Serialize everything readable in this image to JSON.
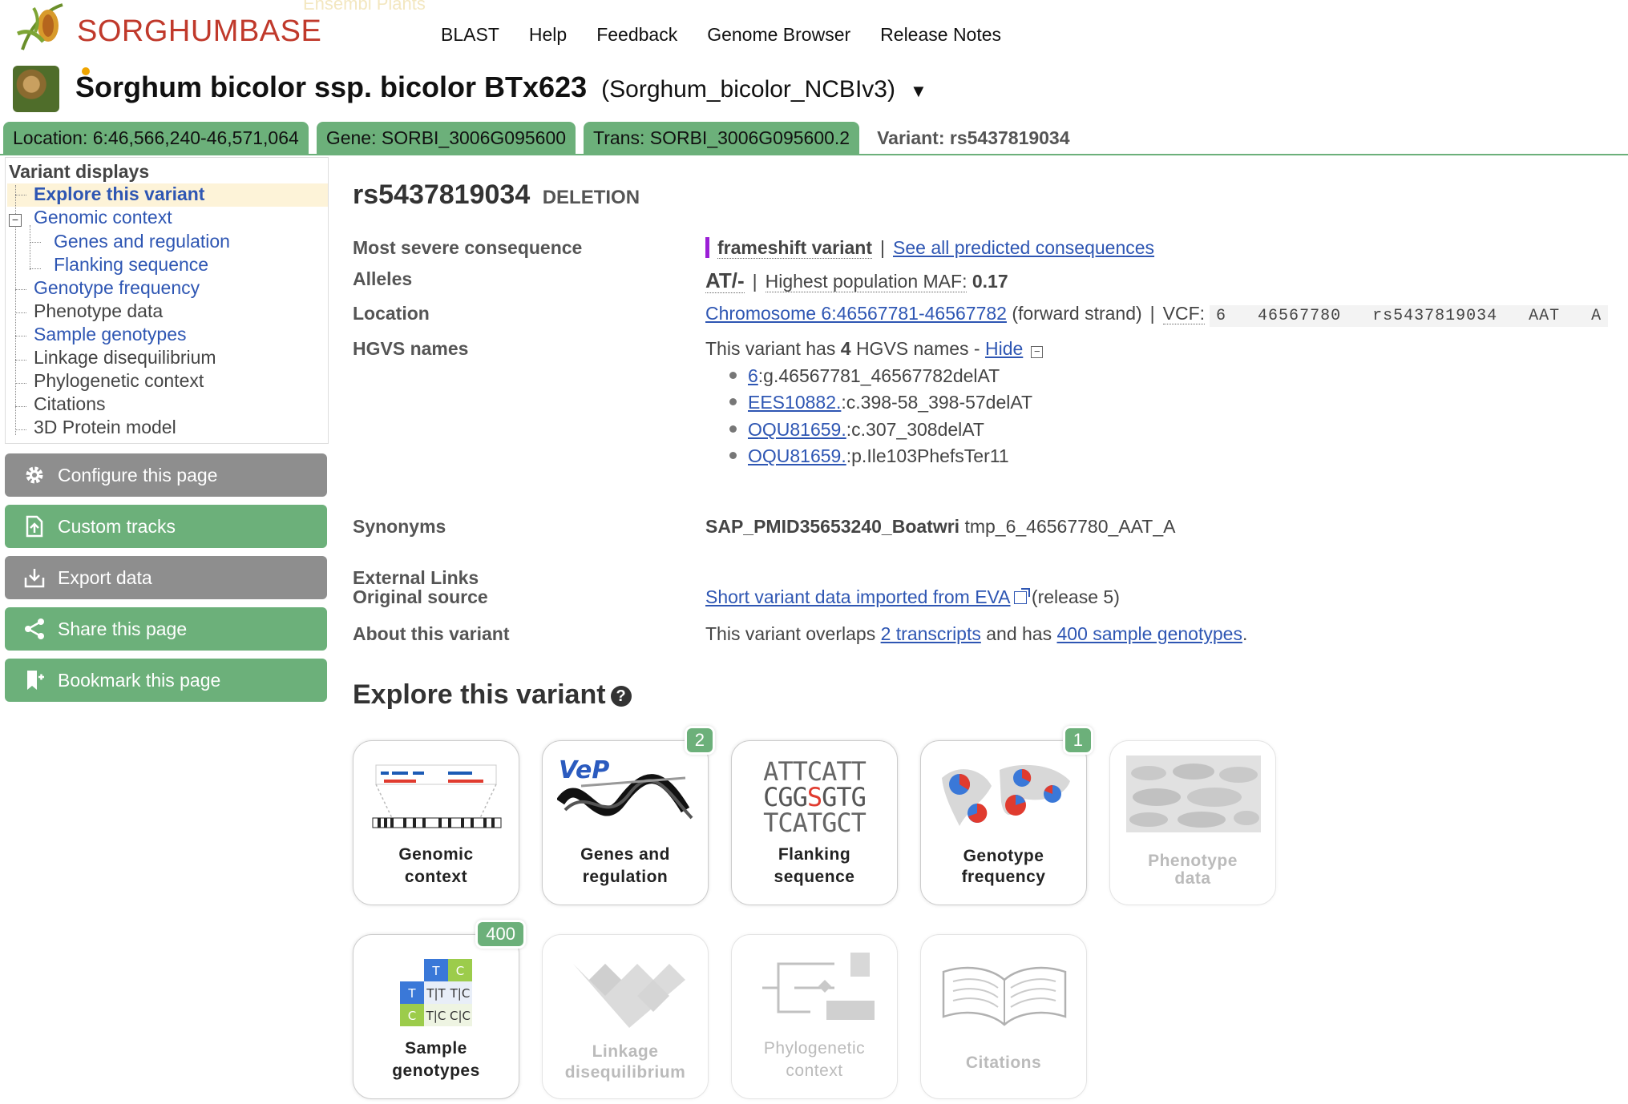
{
  "header": {
    "logo_text": "SORGHUMBASE",
    "ghost_text": "Ensembl Plants",
    "nav": [
      "BLAST",
      "Help",
      "Feedback",
      "Genome Browser",
      "Release Notes"
    ]
  },
  "species": {
    "name": "Sorghum bicolor ssp. bicolor BTx623",
    "assembly": "(Sorghum_bicolor_NCBIv3)",
    "caret": "▼"
  },
  "tabs": {
    "location": "Location: 6:46,566,240-46,571,064",
    "gene": "Gene: SORBI_3006G095600",
    "trans": "Trans: SORBI_3006G095600.2",
    "variant": "Variant: rs5437819034"
  },
  "leftnav": {
    "title": "Variant displays",
    "items": [
      "Explore this variant",
      "Genomic context",
      "Genes and regulation",
      "Flanking sequence",
      "Genotype frequency",
      "Phenotype data",
      "Sample genotypes",
      "Linkage disequilibrium",
      "Phylogenetic context",
      "Citations",
      "3D Protein model"
    ],
    "expander": "−"
  },
  "actions": {
    "configure": "Configure this page",
    "custom_tracks": "Custom tracks",
    "export": "Export data",
    "share": "Share this page",
    "bookmark": "Bookmark this page"
  },
  "variant": {
    "id": "rs5437819034",
    "type": "DELETION",
    "labels": {
      "consequence": "Most severe consequence",
      "alleles": "Alleles",
      "location": "Location",
      "hgvs": "HGVS names",
      "synonyms": "Synonyms",
      "external": "External Links",
      "original_source": "Original source",
      "about": "About this variant"
    },
    "consequence": "frameshift variant",
    "consequence_link": "See all predicted consequences",
    "consequence_color": "#9b1fd6",
    "alleles": "AT/-",
    "maf_label": "Highest population MAF:",
    "maf_value": "0.17",
    "location_link": "Chromosome 6:46567781-46567782",
    "strand": "(forward strand)",
    "vcf_label": "VCF:",
    "vcf_value": "6   46567780   rs5437819034   AAT   A",
    "hgvs_intro_1": "This variant has",
    "hgvs_count": "4",
    "hgvs_intro_2": "HGVS names -",
    "hgvs_hide": "Hide",
    "hgvs_names": [
      {
        "link": "6",
        "rest": ":g.46567781_46567782delAT"
      },
      {
        "link": "EES10882.",
        "rest": ":c.398-58_398-57delAT"
      },
      {
        "link": "OQU81659.",
        "rest": ":c.307_308delAT"
      },
      {
        "link": "OQU81659.",
        "rest": ":p.Ile103PhefsTer11"
      }
    ],
    "synonym_bold": "SAP_PMID35653240_Boatwri",
    "synonym_rest": "tmp_6_46567780_AAT_A",
    "source_link": "Short variant data imported from EVA",
    "source_release": "(release 5)",
    "about_1": "This variant overlaps",
    "about_transcripts": "2 transcripts",
    "about_2": "and has",
    "about_genotypes": "400 sample genotypes",
    "about_3": "."
  },
  "explore": {
    "heading": "Explore this variant",
    "help": "?",
    "tiles": [
      {
        "label1": "Genomic",
        "label2": "context",
        "badge": null
      },
      {
        "label1": "Genes and",
        "label2": "regulation",
        "badge": "2"
      },
      {
        "label1": "Flanking",
        "label2": "sequence",
        "badge": null
      },
      {
        "label1": "Genotype",
        "label2": "frequency",
        "badge": "1"
      },
      {
        "label1": "Phenotype",
        "label2": "data",
        "badge": null
      },
      {
        "label1": "Sample",
        "label2": "genotypes",
        "badge": "400"
      },
      {
        "label1": "Linkage",
        "label2": "disequilibrium",
        "badge": null
      },
      {
        "label1": "Phylogenetic",
        "label2": "context",
        "badge": null
      },
      {
        "label1": "Citations",
        "label2": "",
        "badge": null
      }
    ],
    "vep_logo": "VeP",
    "flank_lines": [
      "ATTCATT",
      "CGGSGTG",
      "TCATGCT"
    ],
    "sample_cells": [
      "T",
      "C",
      "T",
      "T|T",
      "T|C",
      "C",
      "T|C",
      "C|C"
    ]
  },
  "colors": {
    "accent_green": "#6cb07a",
    "button_grey": "#8e8e8e",
    "link_blue": "#2e56b3",
    "logo_red": "#c0392b"
  }
}
